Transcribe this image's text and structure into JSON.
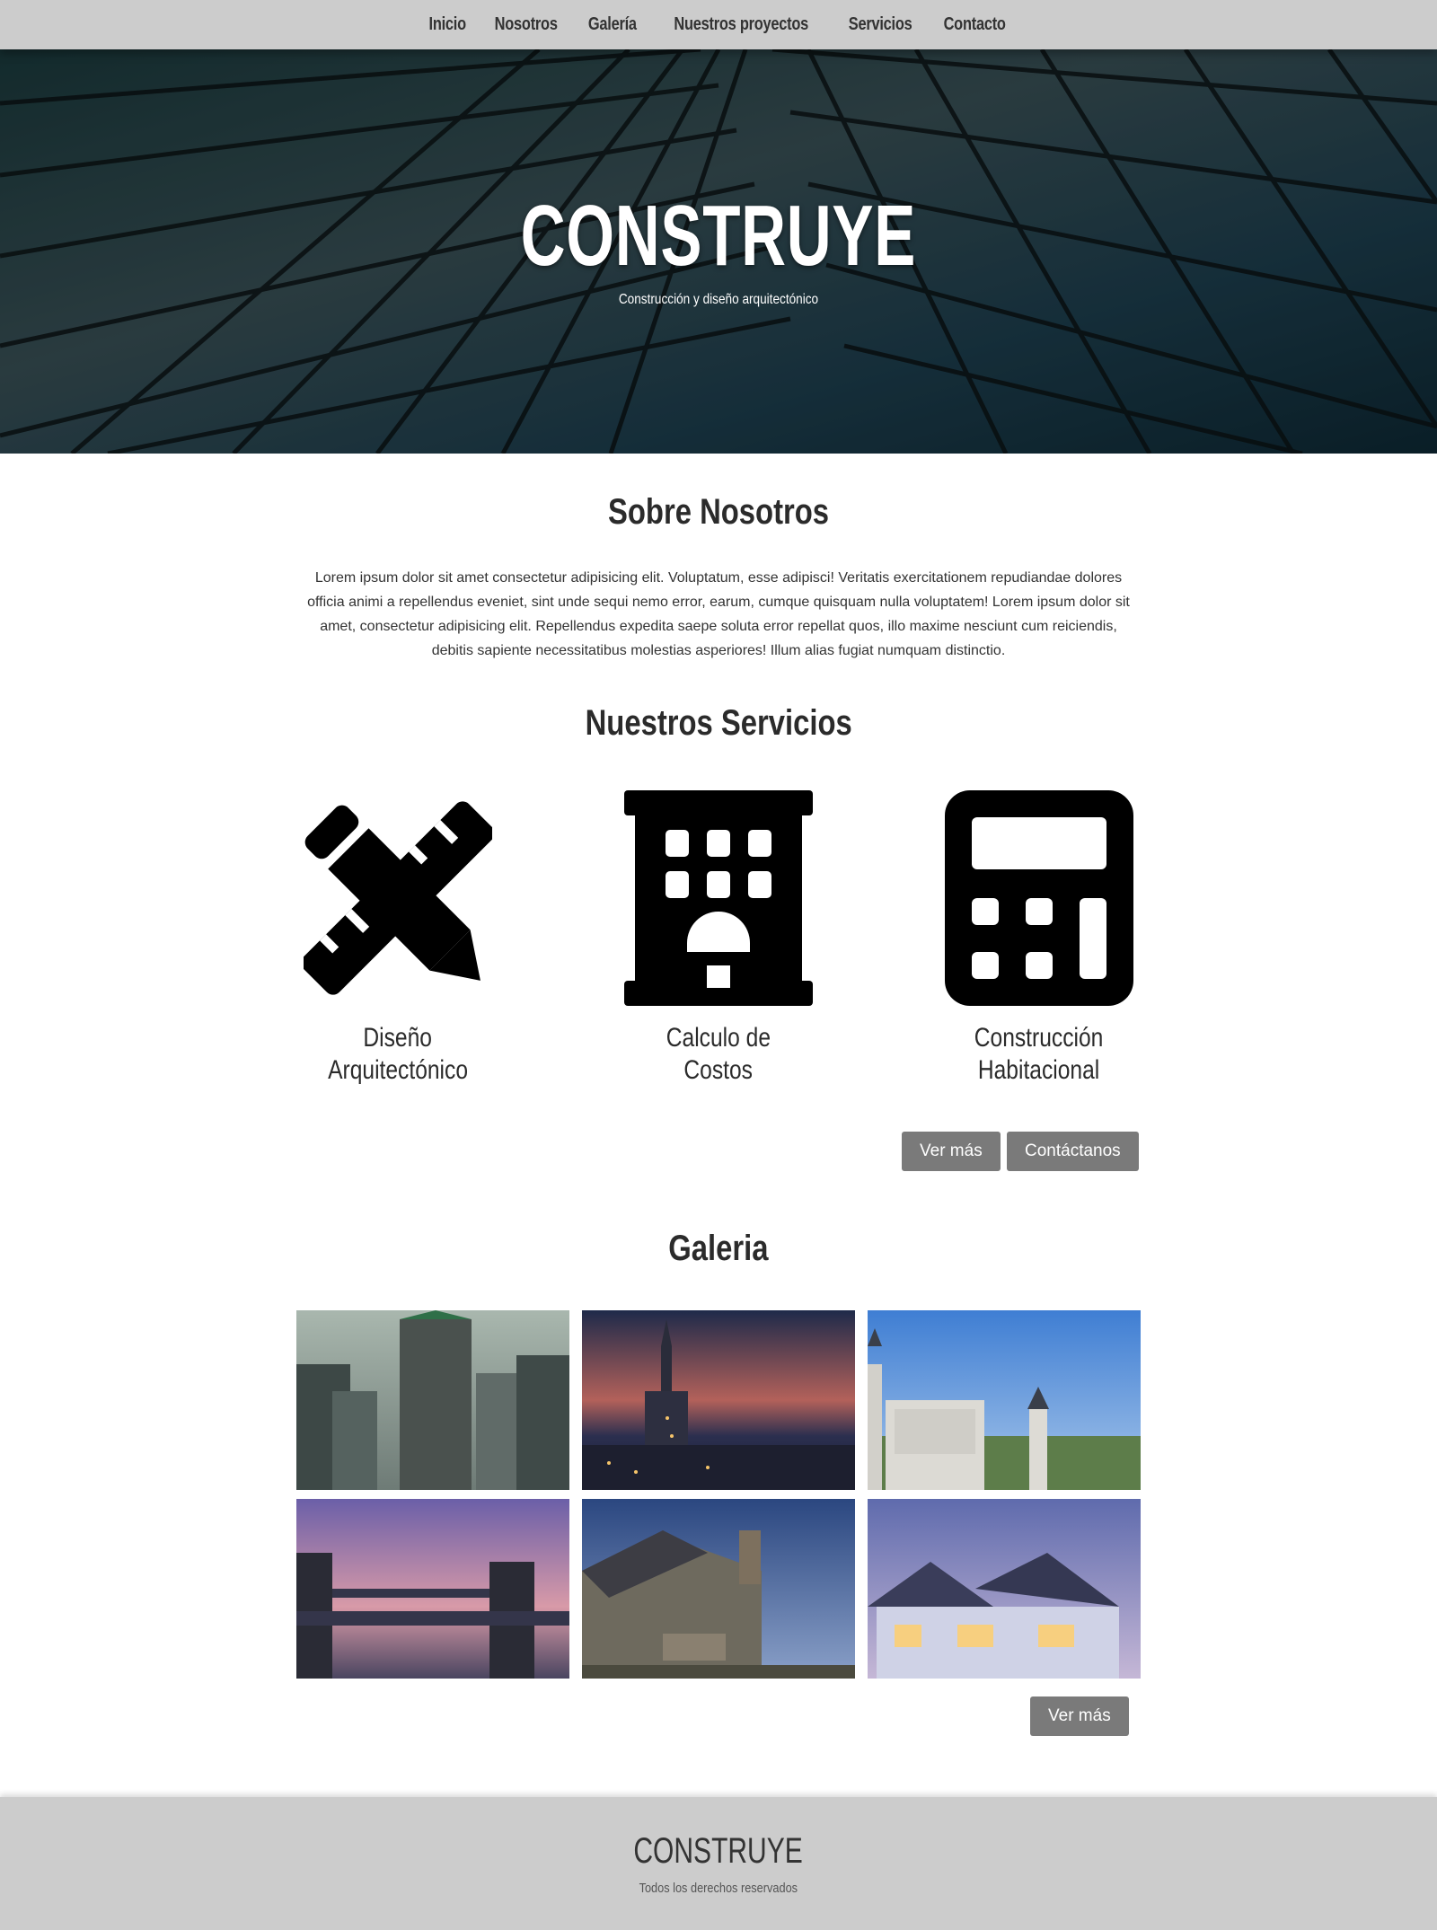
{
  "nav": {
    "items": [
      "Inicio",
      "Nosotros",
      "Galería",
      "Nuestros proyectos",
      "Servicios",
      "Contacto"
    ]
  },
  "hero": {
    "title": "CONSTRUYE",
    "subtitle": "Construcción y diseño arquitectónico"
  },
  "about": {
    "title": "Sobre Nosotros",
    "text": "Lorem ipsum dolor sit amet consectetur adipisicing elit. Voluptatum, esse adipisci! Veritatis exercitationem repudiandae dolores officia animi a repellendus eveniet, sint unde sequi nemo error, earum, cumque quisquam nulla voluptatem! Lorem ipsum dolor sit amet, consectetur adipisicing elit. Repellendus expedita saepe soluta error repellat quos, illo maxime nesciunt cum reiciendis, debitis sapiente necessitatibus molestias asperiores! Illum alias fugiat numquam distinctio."
  },
  "services": {
    "title": "Nuestros Servicios",
    "items": [
      {
        "line1": "Diseño",
        "line2": "Arquitectónico",
        "icon": "pencil-ruler-icon"
      },
      {
        "line1": "Calculo de",
        "line2": "Costos",
        "icon": "building-icon"
      },
      {
        "line1": "Construcción",
        "line2": "Habitacional",
        "icon": "calculator-icon"
      }
    ],
    "more_label": "Ver más",
    "contact_label": "Contáctanos"
  },
  "gallery": {
    "title": "Galeria",
    "more_label": "Ver más"
  },
  "footer": {
    "brand": "CONSTRUYE",
    "copyright": "Todos los derechos reservados"
  },
  "colors": {
    "nav_bg": "#cccccc",
    "button_bg": "#7a7a7a",
    "footer_bg": "#cccccc"
  }
}
